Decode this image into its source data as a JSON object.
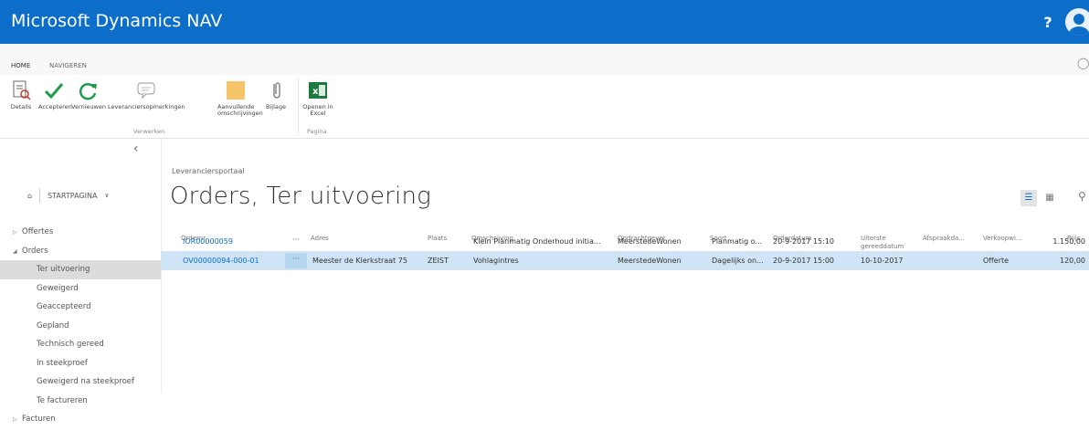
{
  "app": {
    "title": "Microsoft Dynamics NAV",
    "help_label": "?"
  },
  "ribbon": {
    "tabs": [
      "HOME",
      "NAVIGEREN"
    ],
    "buttons": {
      "details": "Details",
      "accept": "Accepteren",
      "refresh": "Vernieuwen",
      "supplier_remarks": "Leveranciersopmerkingen",
      "extra_descriptions": "Aanvullende omschrijvingen",
      "attachment": "Bijlage",
      "open_excel": "Openen in Excel"
    },
    "groups": {
      "process": "Verwerken",
      "page": "Pagina"
    }
  },
  "nav": {
    "home_label": "STARTPAGINA",
    "items": [
      {
        "label": "Offertes"
      },
      {
        "label": "Orders"
      },
      {
        "label": "Ter uitvoering"
      },
      {
        "label": "Geweigerd"
      },
      {
        "label": "Geaccepteerd"
      },
      {
        "label": "Gepland"
      },
      {
        "label": "Technisch gereed"
      },
      {
        "label": "In steekproef"
      },
      {
        "label": "Geweigerd na steekproef"
      },
      {
        "label": "Te factureren"
      },
      {
        "label": "Facturen"
      }
    ]
  },
  "main": {
    "breadcrumb": "Leveranciersportaal",
    "title": "Orders, Ter uitvoering",
    "columns": [
      "Ordernr.",
      "Adres",
      "Plaats",
      "Omschrijving",
      "Opdrachtgever",
      "Soort",
      "Orderdatum",
      "Uiterste gereeddatum",
      "Afspraakda...",
      "Verkoopwi...",
      "Prijs"
    ],
    "rows": [
      {
        "order": "IOR00000059",
        "address": "",
        "city": "",
        "description": "Klein Planmatig Onderhoud initia...",
        "client": "MeerstedeWonen",
        "type": "Planmatig o...",
        "order_date": "20-9-2017 15:10",
        "due_date": "",
        "appointment": "",
        "sales": "",
        "price": "1.150,00"
      },
      {
        "order": "OV00000094-000-01",
        "address": "Meester de Klerkstraat 75",
        "city": "ZEIST",
        "description": "Vohlagintres",
        "client": "MeerstedeWonen",
        "type": "Dagelijks on...",
        "order_date": "20-9-2017 15:00",
        "due_date": "10-10-2017",
        "appointment": "",
        "sales": "Offerte",
        "price": "120,00"
      }
    ],
    "dots_label": "···"
  },
  "colors": {
    "titlebar": "#0c6ec9",
    "selected_row": "#cfe4f6",
    "link": "#0c6ec9"
  }
}
